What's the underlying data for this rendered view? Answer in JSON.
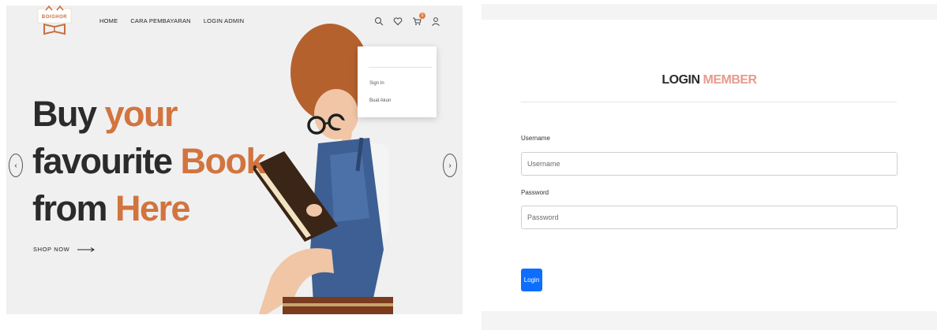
{
  "brand": {
    "logo_text": "BOIGHOR"
  },
  "nav": {
    "items": [
      "HOME",
      "CARA PEMBAYARAN",
      "LOGIN ADMIN"
    ]
  },
  "header_icons": {
    "search": "search-icon",
    "wishlist": "heart-icon",
    "cart": "cart-icon",
    "cart_count": "0",
    "account": "user-icon"
  },
  "dropdown": {
    "items": [
      "Sign In",
      "Buat Akun"
    ]
  },
  "hero": {
    "line1": {
      "plain": "Buy ",
      "accent": "your"
    },
    "line2": {
      "plain": "favourite ",
      "accent": "Book"
    },
    "line3": {
      "plain": "from ",
      "accent": "Here"
    },
    "cta": "SHOP NOW",
    "prev_icon": "‹",
    "next_icon": "›"
  },
  "login": {
    "title_plain": "LOGIN",
    "title_accent": "MEMBER",
    "username_label": "Username",
    "username_placeholder": "Username",
    "password_label": "Password",
    "password_placeholder": "Password",
    "submit_label": "Login"
  },
  "colors": {
    "accent": "#d2743f",
    "title_accent": "#e79a8c",
    "button": "#0d6efd",
    "hero_bg": "#f0f0f0"
  }
}
